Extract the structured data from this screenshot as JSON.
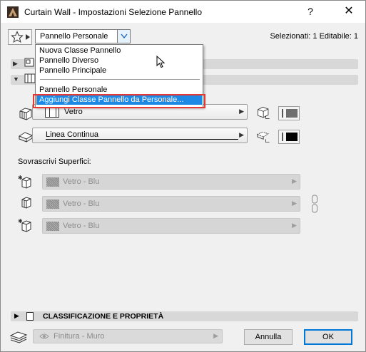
{
  "window": {
    "title": "Curtain Wall - Impostazioni Selezione Pannello",
    "help_glyph": "?",
    "close_glyph": "✕"
  },
  "toolbar": {
    "preset_value": "Pannello Personale",
    "selection_info": "Selezionati: 1 Editabile: 1"
  },
  "dropdown": {
    "items_top": [
      "Nuova Classe Pannello",
      "Pannello Diverso",
      "Pannello Principale"
    ],
    "items_bottom": [
      "Pannello Personale",
      "Aggiungi Classe Pannello da Personale..."
    ],
    "highlighted_index": 1
  },
  "material": {
    "glass_label": "Vetro",
    "line_label": "Linea Continua",
    "pen_fill_color_1": "#6e6e6e",
    "pen_fill_color_2": "#000000"
  },
  "overrides": {
    "heading": "Sovrascrivi Superfici:",
    "surfaces": [
      "Vetro - Blu",
      "Vetro - Blu",
      "Vetro - Blu"
    ]
  },
  "bottom": {
    "section_title": "CLASSIFICAZIONE E PROPRIETÀ",
    "layer_value": "Finitura - Muro",
    "cancel_label": "Annulla",
    "ok_label": "OK"
  },
  "icons": {
    "app": "archicad-icon",
    "favorites": "star-icon",
    "cursor": "mouse-pointer-icon"
  }
}
